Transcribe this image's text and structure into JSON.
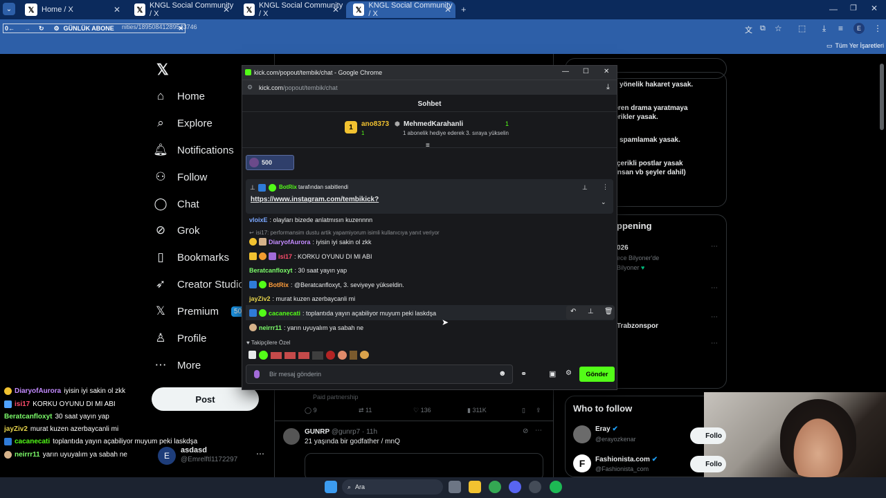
{
  "tabs": [
    {
      "label": "Home / X"
    },
    {
      "label": "KNGL Social Community / X"
    },
    {
      "label": "KNGL Social Community / X"
    },
    {
      "label": "KNGL Social Community / X"
    }
  ],
  "addressbar": {
    "overlay": "GÜNLÜK ABONE",
    "url_tail": "nities/18950841289543746"
  },
  "bookmarks": {
    "folder": "Tüm Yer İşaretleri"
  },
  "nav": [
    {
      "label": "Home",
      "icon": "home-icon"
    },
    {
      "label": "Explore",
      "icon": "search-icon"
    },
    {
      "label": "Notifications",
      "icon": "bell-icon"
    },
    {
      "label": "Follow",
      "icon": "person-plus-icon"
    },
    {
      "label": "Chat",
      "icon": "chat-icon"
    },
    {
      "label": "Grok",
      "icon": "grok-icon"
    },
    {
      "label": "Bookmarks",
      "icon": "bookmark-icon"
    },
    {
      "label": "Creator Studio",
      "icon": "rocket-icon"
    },
    {
      "label": "Premium",
      "icon": "x-icon"
    },
    {
      "label": "Profile",
      "icon": "profile-icon"
    },
    {
      "label": "More",
      "icon": "more-icon"
    }
  ],
  "premium_badge": "50%",
  "post_label": "Post",
  "account": {
    "avatar": "E",
    "name": "asdasd",
    "handle": "@Emrelftl1172297"
  },
  "rules": [
    "yönelik hakaret yasak.",
    "içeren drama yaratmaya",
    "içerikler yasak.",
    "spamlamak yasak.",
    "çerikli postlar yasak",
    "insan vb şeyler dahil)"
  ],
  "happening": {
    "title": "ppening",
    "item1": "026",
    "item1_sub": "ece Bilyoner'de",
    "item1_sub2": "Bilyoner",
    "item2": "Trabzonspor"
  },
  "feed": {
    "partnership": "Paid partnership",
    "replies": "9",
    "reposts": "11",
    "likes": "136",
    "views": "311K",
    "post_user": "GUNRP",
    "post_handle": "@gunrp7 · 11h",
    "post_text": "21 yaşında bir godfather / mnQ"
  },
  "who_to_follow": {
    "title": "Who to follow",
    "items": [
      {
        "name": "Eray",
        "handle": "@erayozkenar",
        "btn": "Follo"
      },
      {
        "name": "Fashionista.com",
        "handle": "@Fashionista_com",
        "btn": "Follo"
      }
    ]
  },
  "popup": {
    "window_title": "kick.com/popout/tembik/chat - Google Chrome",
    "url_domain": "kick.com",
    "url_path": "/popout/tembik/chat",
    "header": "Sohbet",
    "leader": {
      "user": "ano8373",
      "count": "1",
      "top_user": "MehmedKarahanli",
      "top_count": "1",
      "sub_text": "1 abonelik hediye ederek 3. sıraya yükselin"
    },
    "gift_count": "500",
    "pinned": {
      "by": "BotRix",
      "by_suffix": "tarafından sabitlendi",
      "link": "https://www.instagram.com/tembikick?"
    },
    "messages": [
      {
        "user": "vloixE",
        "text": ": olayları bizede anlatmısın kuzennnn",
        "color": "#7aa7ff"
      },
      {
        "user": "",
        "text": "isi17: performansim dustu artik yapamiyorum isimli kullanıcıya yanıt veriyor",
        "color": "#8a8d91",
        "reply": true
      },
      {
        "user": "DiaryofAurora",
        "text": ": iyisin iyi sakin ol zkk",
        "color": "#c38bff"
      },
      {
        "user": "isi17",
        "text": ": KORKU OYUNU DI MI ABI",
        "color": "#ff4d6d"
      },
      {
        "user": "Beratcanfloxyt",
        "text": ": 30 saat yayın yap",
        "color": "#7cfc6a"
      },
      {
        "user": "BotRix",
        "text": ": @Beratcanfloxyt, 3. seviyeye yükseldin.",
        "color": "#ff9d3a"
      },
      {
        "user": "jayZiv2",
        "text": ": murat kuzen azerbaycanli mi",
        "color": "#e6d34b"
      },
      {
        "user": "cacanecati",
        "text": ": toplantıda yayın açabiliyor muyum peki laskdşa",
        "color": "#53fc18"
      },
      {
        "user": "neirrr11",
        "text": ": yarın uyuyalım ya sabah ne",
        "color": "#7cfc6a"
      }
    ],
    "followers_label": "Takipçilere Özel",
    "input_placeholder": "Bir mesaj gönderin",
    "send_label": "Gönder"
  },
  "overlay_chat": [
    {
      "user": "DiaryofAurora",
      "text": "iyisin iyi sakin ol zkk",
      "color": "#c38bff"
    },
    {
      "user": "isi17",
      "text": "KORKU OYUNU DI MI ABI",
      "color": "#ff4d6d"
    },
    {
      "user": "Beratcanfloxyt",
      "text": "30 saat yayın yap",
      "color": "#7cfc6a"
    },
    {
      "user": "jayZiv2",
      "text": "murat kuzen azerbaycanli mi",
      "color": "#e6d34b"
    },
    {
      "user": "cacanecati",
      "text": "toplantıda yayın açabiliyor muyum peki laskdşa",
      "color": "#53fc18"
    },
    {
      "user": "neirrr11",
      "text": "yarın uyuyalım ya sabah ne",
      "color": "#7cfc6a"
    }
  ],
  "taskbar": {
    "search": "Ara"
  },
  "colors": {
    "kick_green": "#53fc18",
    "x_blue": "#1d9bf0",
    "chrome_blue": "#2d5fa8"
  }
}
